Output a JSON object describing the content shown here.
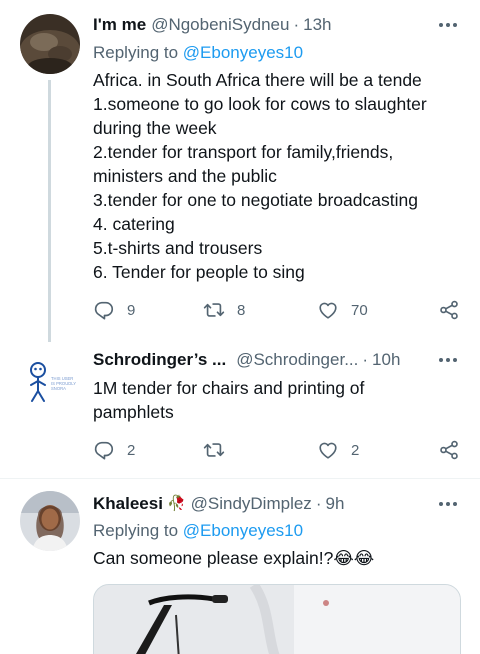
{
  "tweets": [
    {
      "name": "I'm me",
      "handle": "@NgobeniSydneu",
      "time": "13h",
      "replying_prefix": "Replying to",
      "replying_to": "@Ebonyeyes10",
      "lines": [
        "Africa. in South Africa there will be a tende",
        "1.someone to go look for cows to slaughter",
        "during the week",
        "2.tender for transport for family,friends,",
        "ministers and the public",
        "3.tender for one to negotiate broadcasting",
        "4. catering",
        "5.t-shirts and trousers",
        "6. Tender for people to sing"
      ],
      "replies": "9",
      "retweets": "8",
      "likes": "70"
    },
    {
      "name": "Schrodinger’s ...",
      "handle": "@Schrodinger...",
      "time": "10h",
      "avatar_text": "THIS USER IS PROUDLY SNORA",
      "lines": [
        "1M tender for chairs and printing of",
        "pamphlets"
      ],
      "replies": "2",
      "retweets": "",
      "likes": "2"
    },
    {
      "name": "Khaleesi",
      "name_emoji": "🥀",
      "handle": "@SindyDimplez",
      "time": "9h",
      "replying_prefix": "Replying to",
      "replying_to": "@Ebonyeyes10",
      "text": "Can someone please explain!?",
      "emoji": "😂😂"
    }
  ],
  "separator": "·",
  "icons": [
    "reply-icon",
    "retweet-icon",
    "like-icon",
    "share-icon",
    "more-icon"
  ],
  "colors": {
    "text": "#0f1419",
    "secondary": "#536471",
    "accent": "#1d9bf0",
    "divider": "#eff3f4",
    "thread_line": "#cfd9de"
  }
}
